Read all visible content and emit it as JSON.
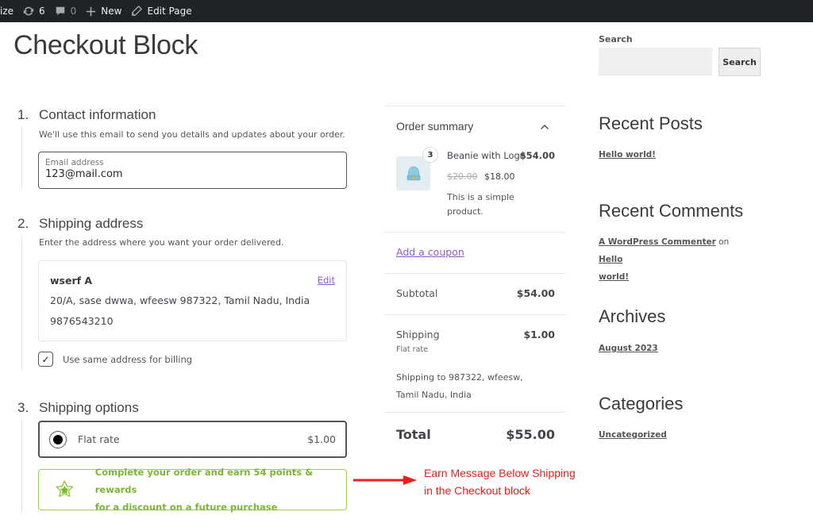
{
  "adminbar": {
    "customize_fragment": "ize",
    "updates_count": "6",
    "comments_count": "0",
    "new_label": "New",
    "edit_label": "Edit Page"
  },
  "page": {
    "title": "Checkout Block"
  },
  "contact": {
    "number": "1.",
    "title": "Contact information",
    "description": "We'll use this email to send you details and updates about your order.",
    "email_label": "Email address",
    "email_value": "123@mail.com"
  },
  "shipping_address": {
    "number": "2.",
    "title": "Shipping address",
    "description": "Enter the address where you want your order delivered.",
    "name": "wserf A",
    "edit_label": "Edit",
    "address_line": "20/A, sase dwwa, wfeesw 987322, Tamil Nadu, India",
    "phone": "9876543210",
    "billing_checkbox_label": "Use same address for billing",
    "billing_checked": true
  },
  "shipping_options": {
    "number": "3.",
    "title": "Shipping options",
    "option_label": "Flat rate",
    "option_price": "$1.00",
    "selected": true
  },
  "earn_message": {
    "line1": "Complete your order and earn 54 points & rewards",
    "line2": "for a discount on a future purchase",
    "color": "#7cb82f"
  },
  "order_summary": {
    "title": "Order summary",
    "product": {
      "quantity": "3",
      "name": "Beanie with Logo",
      "line_total": "$54.00",
      "regular_price": "$20.00",
      "sale_price": "$18.00",
      "description": "This is a simple product."
    },
    "coupon_label": "Add a coupon",
    "subtotal_label": "Subtotal",
    "subtotal_value": "$54.00",
    "shipping_label": "Shipping",
    "shipping_value": "$1.00",
    "shipping_method": "Flat rate",
    "shipping_to": "Shipping to 987322, wfeesw, Tamil Nadu, India",
    "total_label": "Total",
    "total_value": "$55.00"
  },
  "annotation": {
    "line1": "Earn Message Below Shipping",
    "line2": "in the Checkout block",
    "color": "#ee1c1c"
  },
  "sidebar": {
    "search_label": "Search",
    "search_value": "",
    "search_button": "Search",
    "recent_posts_title": "Recent Posts",
    "recent_posts": [
      "Hello world!"
    ],
    "recent_comments_title": "Recent Comments",
    "comment_author": "A WordPress Commenter",
    "comment_on": "on",
    "comment_post_part1": "Hello",
    "comment_post_part2": "world!",
    "archives_title": "Archives",
    "archives": [
      "August 2023"
    ],
    "categories_title": "Categories",
    "categories": [
      "Uncategorized"
    ]
  },
  "colors": {
    "link_purple": "#8f5bd1",
    "adminbar_bg": "#1d2327",
    "earn_border": "#9fcb4a"
  }
}
